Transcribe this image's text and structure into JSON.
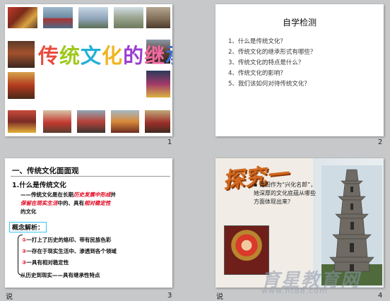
{
  "slides": [
    {
      "number": "1",
      "title": "传统文化的继承",
      "title_colors": [
        "#e84c3d",
        "#a0c81e",
        "#22b0d6",
        "#f0b51e",
        "#9b3fd1",
        "#f36aa4",
        "#3b6fd8"
      ]
    },
    {
      "number": "2",
      "title": "自学检测",
      "items": [
        "1、什么是传统文化？",
        "2、传统文化的继承形式有哪些？",
        "3、传统文化的特点是什么？",
        "4、传统文化的影响？",
        "5、我们该如何对待传统文化？"
      ]
    },
    {
      "number": "3",
      "heading": "一、传统文化面面观",
      "subheading": "1.什么是传统文化",
      "def_parts": [
        "——传统文化是在长期",
        "历史发展中形成",
        "并",
        "保留在现实生活",
        "中的、具有",
        "相对稳定性",
        "的文化"
      ],
      "concept_label": "概念解析：",
      "items": [
        {
          "mark": "①",
          "text": "一打上了历史的烙印、带有民族色彩"
        },
        {
          "mark": "②",
          "text": "一存在于现实生活中、渗透到各个领域"
        },
        {
          "mark": "③",
          "text": "一具有相对稳定性"
        }
      ],
      "last": "从历史到现实——具有继承性特点",
      "side_mark": "说"
    },
    {
      "number": "4",
      "heading": "探究一",
      "text": "莆田作为“兴化名郎”，她深厚的文化底蕴从哪些方面体现出来？",
      "side_mark": "说"
    }
  ],
  "watermark": {
    "text": "育星教育网",
    "url": "www.ht88.com"
  }
}
